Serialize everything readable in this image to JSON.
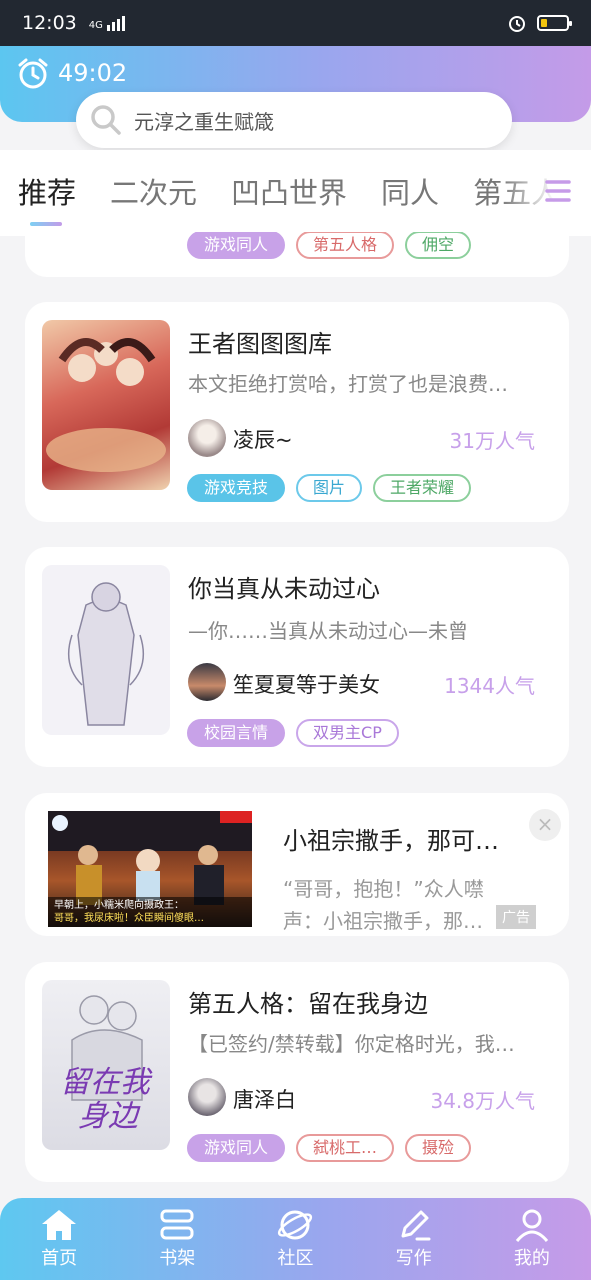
{
  "status_bar": {
    "time": "12:03",
    "network": "4G"
  },
  "timer": {
    "value": "49:02"
  },
  "search": {
    "placeholder": "元淳之重生赋箴"
  },
  "tabs": [
    {
      "label": "推荐",
      "active": true
    },
    {
      "label": "二次元"
    },
    {
      "label": "凹凸世界"
    },
    {
      "label": "同人"
    },
    {
      "label": "第五人"
    }
  ],
  "cards": [
    {
      "tags": [
        {
          "label": "游戏同人"
        },
        {
          "label": "第五人格"
        },
        {
          "label": "佣空"
        }
      ]
    },
    {
      "title": "王者图图图库",
      "desc": "本文拒绝打赏哈，打赏了也是浪费…",
      "author": "凌辰~",
      "popularity": "31万人气",
      "tags": [
        {
          "label": "游戏竞技"
        },
        {
          "label": "图片"
        },
        {
          "label": "王者荣耀"
        }
      ]
    },
    {
      "title": "你当真从未动过心",
      "desc": "—你……当真从未动过心—未曾",
      "author": "笙夏夏等于美女",
      "popularity": "1344人气",
      "tags": [
        {
          "label": "校园言情"
        },
        {
          "label": "双男主CP"
        }
      ]
    },
    {
      "title": "第五人格：留在我身边",
      "desc": "【已签约/禁转载】你定格时光，我…",
      "author": "唐泽白",
      "popularity": "34.8万人气",
      "tags": [
        {
          "label": "游戏同人"
        },
        {
          "label": "弑桃工…"
        },
        {
          "label": "摄殓"
        }
      ]
    }
  ],
  "ad": {
    "title": "小祖宗撒手，那可…",
    "desc_line1": "“哥哥，抱抱！”众人噤",
    "desc_line2": "声：小祖宗撒手，那…",
    "badge": "广告",
    "image_caption1": "早朝上，小糯米爬向摄政王：",
    "image_caption2": "哥哥，我尿床啦！众臣瞬间傻眼…"
  },
  "bottom_nav": [
    {
      "label": "首页",
      "icon": "home-icon"
    },
    {
      "label": "书架",
      "icon": "bookshelf-icon"
    },
    {
      "label": "社区",
      "icon": "planet-icon"
    },
    {
      "label": "写作",
      "icon": "pen-icon"
    },
    {
      "label": "我的",
      "icon": "user-icon"
    }
  ]
}
